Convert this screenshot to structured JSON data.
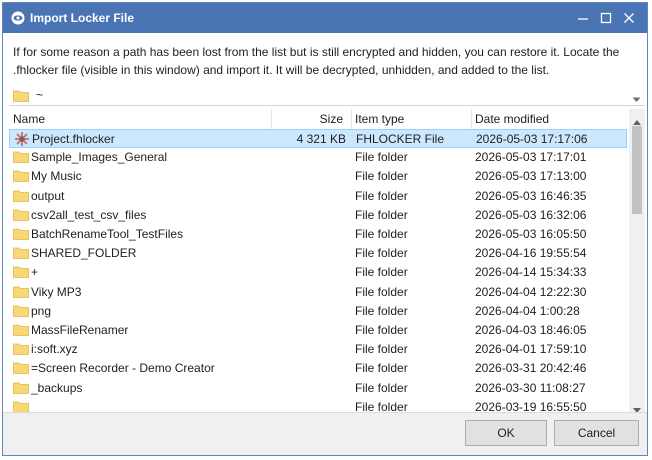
{
  "window": {
    "title": "Import Locker File",
    "accent": "#4a74b4"
  },
  "description": "If for some reason a path has been lost from the list but is still encrypted and hidden, you can restore it. Locate the .fhlocker file (visible in this window) and import it. It will be decrypted, unhidden, and added to the list.",
  "path": {
    "value": "~"
  },
  "columns": {
    "name": "Name",
    "size": "Size",
    "type": "Item type",
    "date": "Date modified"
  },
  "rows": [
    {
      "name": "Project.fhlocker",
      "size": "4 321 KB",
      "type": "FHLOCKER File",
      "date": "2026-05-03 17:17:06",
      "icon": "locker-file-icon",
      "selected": true
    },
    {
      "name": "Sample_Images_General",
      "size": "",
      "type": "File folder",
      "date": "2026-05-03 17:17:01",
      "icon": "folder-icon"
    },
    {
      "name": "My Music",
      "size": "",
      "type": "File folder",
      "date": "2026-05-03 17:13:00",
      "icon": "folder-icon"
    },
    {
      "name": "output",
      "size": "",
      "type": "File folder",
      "date": "2026-05-03 16:46:35",
      "icon": "folder-icon"
    },
    {
      "name": "csv2all_test_csv_files",
      "size": "",
      "type": "File folder",
      "date": "2026-05-03 16:32:06",
      "icon": "folder-icon"
    },
    {
      "name": "BatchRenameTool_TestFiles",
      "size": "",
      "type": "File folder",
      "date": "2026-05-03 16:05:50",
      "icon": "folder-icon"
    },
    {
      "name": "SHARED_FOLDER",
      "size": "",
      "type": "File folder",
      "date": "2026-04-16 19:55:54",
      "icon": "folder-icon"
    },
    {
      "name": "+",
      "size": "",
      "type": "File folder",
      "date": "2026-04-14 15:34:33",
      "icon": "folder-icon"
    },
    {
      "name": "Viky MP3",
      "size": "",
      "type": "File folder",
      "date": "2026-04-04 12:22:30",
      "icon": "folder-icon"
    },
    {
      "name": "png",
      "size": "",
      "type": "File folder",
      "date": "2026-04-04 1:00:28",
      "icon": "folder-icon"
    },
    {
      "name": "MassFileRenamer",
      "size": "",
      "type": "File folder",
      "date": "2026-04-03 18:46:05",
      "icon": "folder-icon"
    },
    {
      "name": "i:soft.xyz",
      "size": "",
      "type": "File folder",
      "date": "2026-04-01 17:59:10",
      "icon": "folder-icon"
    },
    {
      "name": "=Screen Recorder - Demo Creator",
      "size": "",
      "type": "File folder",
      "date": "2026-03-31 20:42:46",
      "icon": "folder-icon"
    },
    {
      "name": "_backups",
      "size": "",
      "type": "File folder",
      "date": "2026-03-30 11:08:27",
      "icon": "folder-icon"
    },
    {
      "name": "",
      "size": "",
      "type": "File folder",
      "date": "2026-03-19 16:55:50",
      "icon": "folder-icon"
    }
  ],
  "buttons": {
    "ok": "OK",
    "cancel": "Cancel"
  }
}
